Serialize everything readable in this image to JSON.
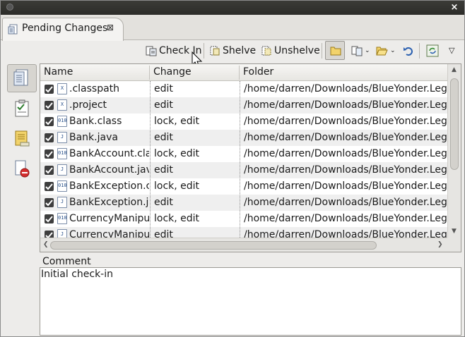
{
  "window": {
    "close_label": "×"
  },
  "tab": {
    "label": "Pending Changes",
    "close_label": "⊠"
  },
  "toolbar": {
    "check_in_label": "Check In",
    "shelve_label": "Shelve",
    "unshelve_label": "Unshelve"
  },
  "table": {
    "headers": {
      "name": "Name",
      "change": "Change",
      "folder": "Folder"
    },
    "rows": [
      {
        "name": ".classpath",
        "icon": "xml-file-icon",
        "change": "edit",
        "folder": "/home/darren/Downloads/BlueYonder.Legacy",
        "checked": true
      },
      {
        "name": ".project",
        "icon": "xml-file-icon",
        "change": "edit",
        "folder": "/home/darren/Downloads/BlueYonder.Legacy",
        "checked": true
      },
      {
        "name": "Bank.class",
        "icon": "class-file-icon",
        "change": "lock, edit",
        "folder": "/home/darren/Downloads/BlueYonder.Legacy",
        "checked": true
      },
      {
        "name": "Bank.java",
        "icon": "java-file-icon",
        "change": "edit",
        "folder": "/home/darren/Downloads/BlueYonder.Legacy",
        "checked": true
      },
      {
        "name": "BankAccount.class",
        "icon": "class-file-icon",
        "change": "lock, edit",
        "folder": "/home/darren/Downloads/BlueYonder.Legacy",
        "checked": true
      },
      {
        "name": "BankAccount.java",
        "icon": "java-file-icon",
        "change": "edit",
        "folder": "/home/darren/Downloads/BlueYonder.Legacy",
        "checked": true
      },
      {
        "name": "BankException.class",
        "icon": "class-file-icon",
        "change": "lock, edit",
        "folder": "/home/darren/Downloads/BlueYonder.Legacy",
        "checked": true
      },
      {
        "name": "BankException.java",
        "icon": "java-file-icon",
        "change": "edit",
        "folder": "/home/darren/Downloads/BlueYonder.Legacy",
        "checked": true
      },
      {
        "name": "CurrencyManipulator.class",
        "icon": "class-file-icon",
        "change": "lock, edit",
        "folder": "/home/darren/Downloads/BlueYonder.Legacy",
        "checked": true
      },
      {
        "name": "CurrencyManipulator.java",
        "icon": "java-file-icon",
        "change": "edit",
        "folder": "/home/darren/Downloads/BlueYonder.Legacy",
        "checked": true
      }
    ]
  },
  "comment": {
    "label": "Comment",
    "value": "Initial check-in"
  }
}
